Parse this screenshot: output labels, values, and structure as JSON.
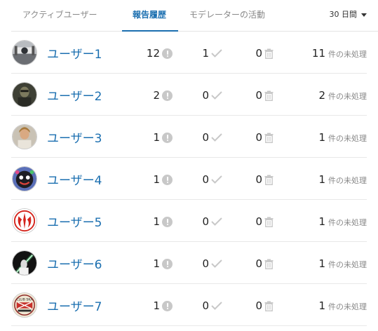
{
  "tabs": [
    {
      "label": "アクティブユーザー",
      "active": false
    },
    {
      "label": "報告履歴",
      "active": true
    },
    {
      "label": "モデレーターの活動",
      "active": false
    }
  ],
  "period": {
    "label": "30 日間"
  },
  "colors": {
    "accent": "#1b6fb0",
    "muted": "#888888",
    "icon": "#c8c8c8"
  },
  "users": [
    {
      "name": "ユーザー1",
      "flags": "12",
      "agreed": "1",
      "deleted": "0",
      "pending": "11",
      "pending_label": "件の未処理",
      "avatar": "tie-fighter-avatar"
    },
    {
      "name": "ユーザー2",
      "flags": "2",
      "agreed": "0",
      "deleted": "0",
      "pending": "2",
      "pending_label": "件の未処理",
      "avatar": "soldier-avatar"
    },
    {
      "name": "ユーザー3",
      "flags": "1",
      "agreed": "0",
      "deleted": "0",
      "pending": "1",
      "pending_label": "件の未処理",
      "avatar": "portrait-avatar"
    },
    {
      "name": "ユーザー4",
      "flags": "1",
      "agreed": "0",
      "deleted": "0",
      "pending": "1",
      "pending_label": "件の未処理",
      "avatar": "character-avatar"
    },
    {
      "name": "ユーザー5",
      "flags": "1",
      "agreed": "0",
      "deleted": "0",
      "pending": "1",
      "pending_label": "件の未処理",
      "avatar": "rebel-emblem-avatar"
    },
    {
      "name": "ユーザー6",
      "flags": "1",
      "agreed": "0",
      "deleted": "0",
      "pending": "1",
      "pending_label": "件の未処理",
      "avatar": "lightsaber-avatar"
    },
    {
      "name": "ユーザー7",
      "flags": "1",
      "agreed": "0",
      "deleted": "0",
      "pending": "1",
      "pending_label": "件の未処理",
      "avatar": "club-badge-avatar",
      "avatar_text": "CLUB SKA"
    }
  ]
}
